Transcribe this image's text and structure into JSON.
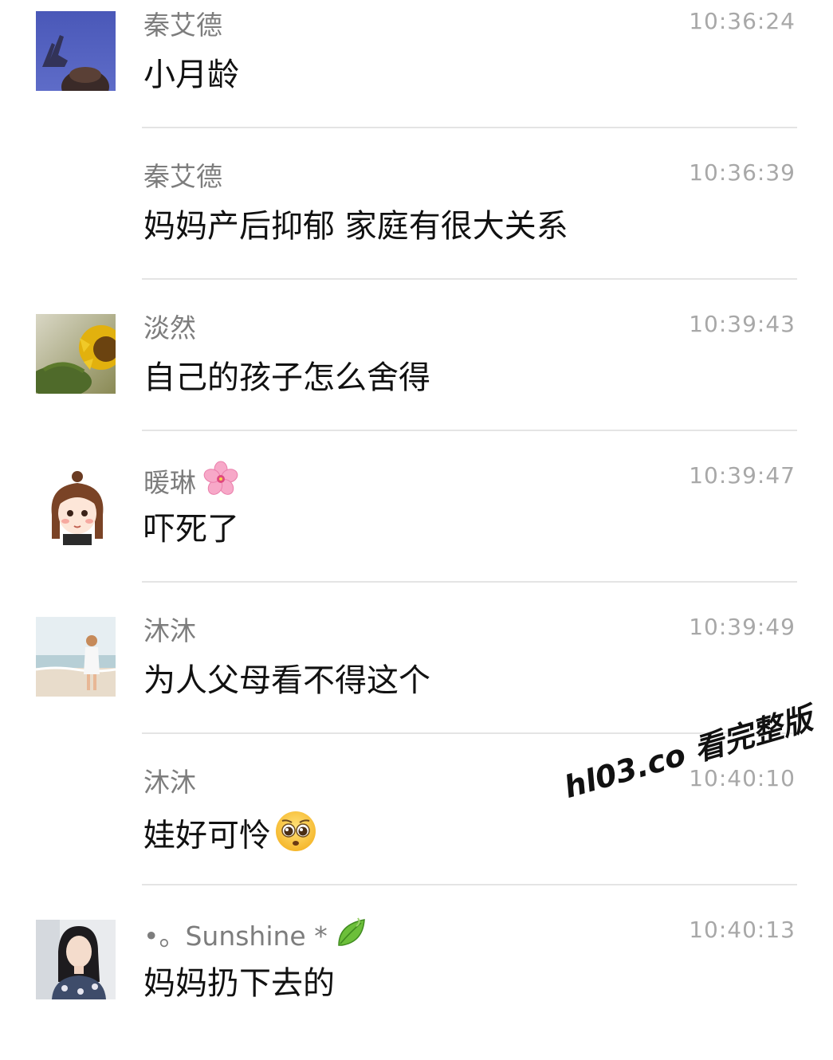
{
  "messages": [
    {
      "sender": "秦艾德",
      "time": "10:36:24",
      "text": "小月龄",
      "show_avatar": true,
      "avatar_icon": "hand-peace-avatar"
    },
    {
      "sender": "秦艾德",
      "time": "10:36:39",
      "text": "妈妈产后抑郁 家庭有很大关系",
      "show_avatar": false
    },
    {
      "sender": "淡然",
      "time": "10:39:43",
      "text": "自己的孩子怎么舍得",
      "show_avatar": true,
      "avatar_icon": "sunflower-avatar"
    },
    {
      "sender": "暖琳",
      "sender_emoji": "cherry-blossom-icon",
      "time": "10:39:47",
      "text": "吓死了",
      "show_avatar": true,
      "avatar_icon": "cartoon-girl-avatar"
    },
    {
      "sender": "沐沐",
      "time": "10:39:49",
      "text": "为人父母看不得这个",
      "show_avatar": true,
      "avatar_icon": "beach-girl-avatar"
    },
    {
      "sender": "沐沐",
      "time": "10:40:10",
      "text": "娃好可怜",
      "text_emoji": "pleading-face-icon",
      "show_avatar": false
    },
    {
      "sender": "•。Sunshine *",
      "sender_emoji": "leaf-icon",
      "time": "10:40:13",
      "text": "妈妈扔下去的",
      "show_avatar": true,
      "avatar_icon": "woman-photo-avatar"
    }
  ],
  "watermark": "hl03.co 看完整版"
}
